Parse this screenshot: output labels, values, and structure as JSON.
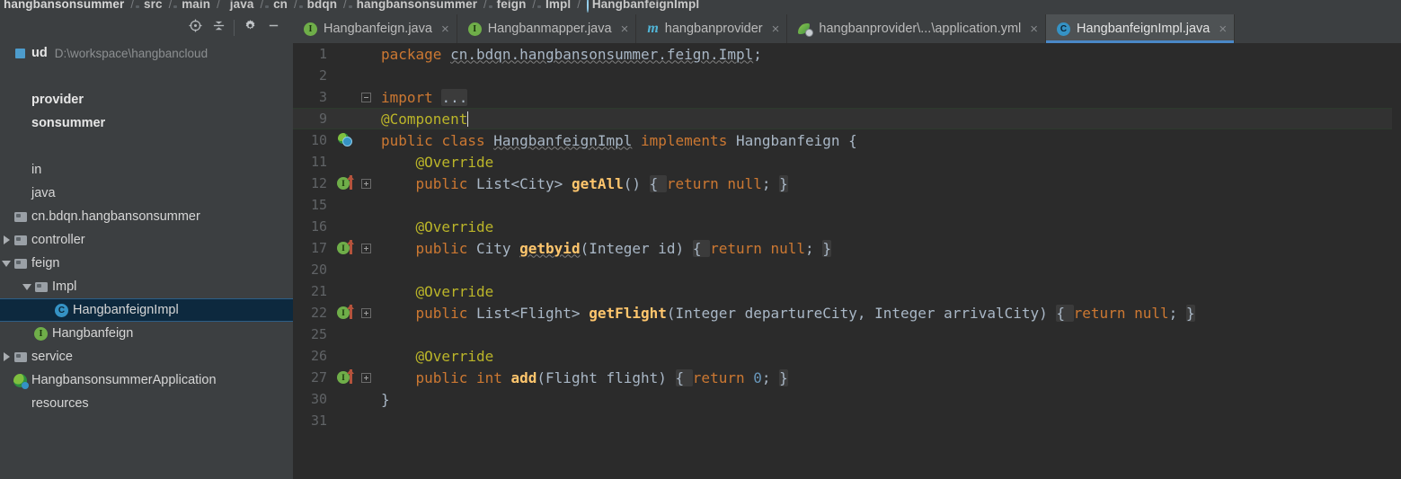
{
  "breadcrumb": {
    "separator": "/",
    "segments": [
      {
        "label": "hangbansonsummer",
        "icon": "module-icon"
      },
      {
        "label": "src",
        "icon": "folder-icon"
      },
      {
        "label": "main",
        "icon": "folder-icon"
      },
      {
        "label": "java",
        "icon": "source-folder-icon"
      },
      {
        "label": "cn",
        "icon": "folder-icon"
      },
      {
        "label": "bdqn",
        "icon": "folder-icon"
      },
      {
        "label": "hangbansonsummer",
        "icon": "folder-icon"
      },
      {
        "label": "feign",
        "icon": "folder-icon"
      },
      {
        "label": "Impl",
        "icon": "folder-icon"
      },
      {
        "label": "HangbanfeignImpl",
        "icon": "class-icon"
      }
    ]
  },
  "project_toolbar": {
    "buttons": [
      {
        "name": "locate-file-button",
        "icon": "crosshair-icon",
        "tooltip": "Select Opened File"
      },
      {
        "name": "collapse-all-button",
        "icon": "collapse-all-icon",
        "tooltip": "Collapse All"
      },
      {
        "name": "settings-button",
        "icon": "gear-icon",
        "tooltip": "Settings"
      },
      {
        "name": "hide-button",
        "icon": "minimize-icon",
        "tooltip": "Hide"
      }
    ]
  },
  "project_tree": {
    "rows": [
      {
        "label": "ud",
        "path_hint": "D:\\workspace\\hangbancloud",
        "icon": "module-icon",
        "indent": 0,
        "twisty": "none",
        "bold": true,
        "selected": false
      },
      {
        "label": "",
        "path_hint": "",
        "icon": "none",
        "indent": 0,
        "twisty": "none",
        "bold": false,
        "selected": false
      },
      {
        "label": "provider",
        "path_hint": "",
        "icon": "none",
        "indent": 0,
        "twisty": "none",
        "bold": true,
        "selected": false
      },
      {
        "label": "sonsummer",
        "path_hint": "",
        "icon": "none",
        "indent": 0,
        "twisty": "none",
        "bold": true,
        "selected": false
      },
      {
        "label": "",
        "path_hint": "",
        "icon": "none",
        "indent": 0,
        "twisty": "none",
        "bold": false,
        "selected": false
      },
      {
        "label": "in",
        "path_hint": "",
        "icon": "none",
        "indent": 0,
        "twisty": "none",
        "bold": false,
        "selected": false
      },
      {
        "label": "java",
        "path_hint": "",
        "icon": "none",
        "indent": 0,
        "twisty": "none",
        "bold": false,
        "selected": false
      },
      {
        "label": "cn.bdqn.hangbansonsummer",
        "path_hint": "",
        "icon": "package-icon",
        "indent": 0,
        "twisty": "none",
        "bold": false,
        "selected": false
      },
      {
        "label": "controller",
        "path_hint": "",
        "icon": "package-icon",
        "indent": 0,
        "twisty": "collapsed",
        "bold": false,
        "selected": false
      },
      {
        "label": "feign",
        "path_hint": "",
        "icon": "package-icon",
        "indent": 0,
        "twisty": "expanded",
        "bold": false,
        "selected": false
      },
      {
        "label": "Impl",
        "path_hint": "",
        "icon": "package-icon",
        "indent": 1,
        "twisty": "expanded",
        "bold": false,
        "selected": false
      },
      {
        "label": "HangbanfeignImpl",
        "path_hint": "",
        "icon": "class-icon",
        "indent": 2,
        "twisty": "none",
        "bold": false,
        "selected": true
      },
      {
        "label": "Hangbanfeign",
        "path_hint": "",
        "icon": "interface-icon",
        "indent": 1,
        "twisty": "none",
        "bold": false,
        "selected": false
      },
      {
        "label": "service",
        "path_hint": "",
        "icon": "package-icon",
        "indent": 0,
        "twisty": "collapsed",
        "bold": false,
        "selected": false
      },
      {
        "label": "HangbansonsummerApplication",
        "path_hint": "",
        "icon": "spring-class-icon",
        "indent": 0,
        "twisty": "none",
        "bold": false,
        "selected": false
      },
      {
        "label": "resources",
        "path_hint": "",
        "icon": "none",
        "indent": 0,
        "twisty": "none",
        "bold": false,
        "selected": false
      }
    ]
  },
  "editor_tabs": [
    {
      "label": "Hangbanfeign.java",
      "icon": "interface-icon",
      "active": false,
      "close": "×"
    },
    {
      "label": "Hangbanmapper.java",
      "icon": "interface-icon",
      "active": false,
      "close": "×"
    },
    {
      "label": "hangbanprovider",
      "icon": "maven-icon",
      "active": false,
      "close": "×"
    },
    {
      "label": "hangbanprovider\\...\\application.yml",
      "icon": "yaml-icon",
      "active": false,
      "close": "×"
    },
    {
      "label": "HangbanfeignImpl.java",
      "icon": "class-icon",
      "active": true,
      "close": "×"
    }
  ],
  "code": {
    "language": "java",
    "lines": [
      {
        "num": "1",
        "gutter": "none",
        "fold": "none",
        "current": false,
        "tokens": [
          {
            "t": "package ",
            "c": "kw"
          },
          {
            "t": "cn.bdqn.hangbansonsummer.feign.Impl",
            "c": "plain squiggle-g"
          },
          {
            "t": ";",
            "c": "plain"
          }
        ]
      },
      {
        "num": "2",
        "gutter": "none",
        "fold": "none",
        "current": false,
        "tokens": []
      },
      {
        "num": "3",
        "gutter": "none",
        "fold": "minus",
        "current": false,
        "tokens": [
          {
            "t": "import ",
            "c": "kw"
          },
          {
            "t": "...",
            "c": "fold-ph"
          }
        ]
      },
      {
        "num": "9",
        "gutter": "none",
        "fold": "none",
        "current": true,
        "tokens": [
          {
            "t": "@Component",
            "c": "anno"
          },
          {
            "t": "|CARET|",
            "c": "caret"
          }
        ]
      },
      {
        "num": "10",
        "gutter": "class-impl-marker",
        "fold": "none",
        "current": false,
        "tokens": [
          {
            "t": "public ",
            "c": "kw"
          },
          {
            "t": "class ",
            "c": "kw"
          },
          {
            "t": "HangbanfeignImpl",
            "c": "cname squiggle-g"
          },
          {
            "t": " implements ",
            "c": "kw"
          },
          {
            "t": "Hangbanfeign",
            "c": "cname"
          },
          {
            "t": " {",
            "c": "plain"
          }
        ]
      },
      {
        "num": "11",
        "gutter": "none",
        "fold": "none",
        "current": false,
        "tokens": [
          {
            "t": "    @Override",
            "c": "anno"
          }
        ]
      },
      {
        "num": "12",
        "gutter": "implements-marker",
        "fold": "plus",
        "current": false,
        "tokens": [
          {
            "t": "    ",
            "c": "plain"
          },
          {
            "t": "public ",
            "c": "kw"
          },
          {
            "t": "List<City> ",
            "c": "plain"
          },
          {
            "t": "getAll",
            "c": "mname"
          },
          {
            "t": "() ",
            "c": "plain"
          },
          {
            "t": "{ ",
            "c": "fold-ph"
          },
          {
            "t": "return ",
            "c": "kw"
          },
          {
            "t": "null",
            "c": "kw"
          },
          {
            "t": "; ",
            "c": "plain"
          },
          {
            "t": "}",
            "c": "fold-ph"
          }
        ]
      },
      {
        "num": "15",
        "gutter": "none",
        "fold": "none",
        "current": false,
        "tokens": []
      },
      {
        "num": "16",
        "gutter": "none",
        "fold": "none",
        "current": false,
        "tokens": [
          {
            "t": "    @Override",
            "c": "anno"
          }
        ]
      },
      {
        "num": "17",
        "gutter": "implements-marker",
        "fold": "plus",
        "current": false,
        "tokens": [
          {
            "t": "    ",
            "c": "plain"
          },
          {
            "t": "public ",
            "c": "kw"
          },
          {
            "t": "City ",
            "c": "plain"
          },
          {
            "t": "getbyid",
            "c": "mname squiggle-g"
          },
          {
            "t": "(Integer id) ",
            "c": "plain"
          },
          {
            "t": "{ ",
            "c": "fold-ph"
          },
          {
            "t": "return ",
            "c": "kw"
          },
          {
            "t": "null",
            "c": "kw"
          },
          {
            "t": "; ",
            "c": "plain"
          },
          {
            "t": "}",
            "c": "fold-ph"
          }
        ]
      },
      {
        "num": "20",
        "gutter": "none",
        "fold": "none",
        "current": false,
        "tokens": []
      },
      {
        "num": "21",
        "gutter": "none",
        "fold": "none",
        "current": false,
        "tokens": [
          {
            "t": "    @Override",
            "c": "anno"
          }
        ]
      },
      {
        "num": "22",
        "gutter": "implements-marker",
        "fold": "plus",
        "current": false,
        "tokens": [
          {
            "t": "    ",
            "c": "plain"
          },
          {
            "t": "public ",
            "c": "kw"
          },
          {
            "t": "List<Flight> ",
            "c": "plain"
          },
          {
            "t": "getFlight",
            "c": "mname"
          },
          {
            "t": "(Integer departureCity, Integer arrivalCity) ",
            "c": "plain"
          },
          {
            "t": "{ ",
            "c": "fold-ph"
          },
          {
            "t": "return ",
            "c": "kw"
          },
          {
            "t": "null",
            "c": "kw"
          },
          {
            "t": "; ",
            "c": "plain"
          },
          {
            "t": "}",
            "c": "fold-ph"
          }
        ]
      },
      {
        "num": "25",
        "gutter": "none",
        "fold": "none",
        "current": false,
        "tokens": []
      },
      {
        "num": "26",
        "gutter": "none",
        "fold": "none",
        "current": false,
        "tokens": [
          {
            "t": "    @Override",
            "c": "anno"
          }
        ]
      },
      {
        "num": "27",
        "gutter": "implements-marker",
        "fold": "plus",
        "current": false,
        "tokens": [
          {
            "t": "    ",
            "c": "plain"
          },
          {
            "t": "public ",
            "c": "kw"
          },
          {
            "t": "int ",
            "c": "kw"
          },
          {
            "t": "add",
            "c": "mname"
          },
          {
            "t": "(Flight flight) ",
            "c": "plain"
          },
          {
            "t": "{ ",
            "c": "fold-ph"
          },
          {
            "t": "return ",
            "c": "kw"
          },
          {
            "t": "0",
            "c": "num"
          },
          {
            "t": "; ",
            "c": "plain"
          },
          {
            "t": "}",
            "c": "fold-ph"
          }
        ]
      },
      {
        "num": "30",
        "gutter": "none",
        "fold": "none",
        "current": false,
        "tokens": [
          {
            "t": "}",
            "c": "plain"
          }
        ]
      },
      {
        "num": "31",
        "gutter": "none",
        "fold": "none",
        "current": false,
        "tokens": []
      }
    ]
  },
  "colors": {
    "editor_background": "#2b2b2b",
    "panel_background": "#3c3f41",
    "active_tab_background": "#4e5254",
    "active_tab_underline": "#4a88c7",
    "selection_background": "#0d293e",
    "keyword": "#cc7832",
    "annotation": "#bbb529",
    "method_name": "#ffc66d",
    "number": "#6897bb",
    "plain_text": "#a9b7c6",
    "line_number": "#606366"
  }
}
